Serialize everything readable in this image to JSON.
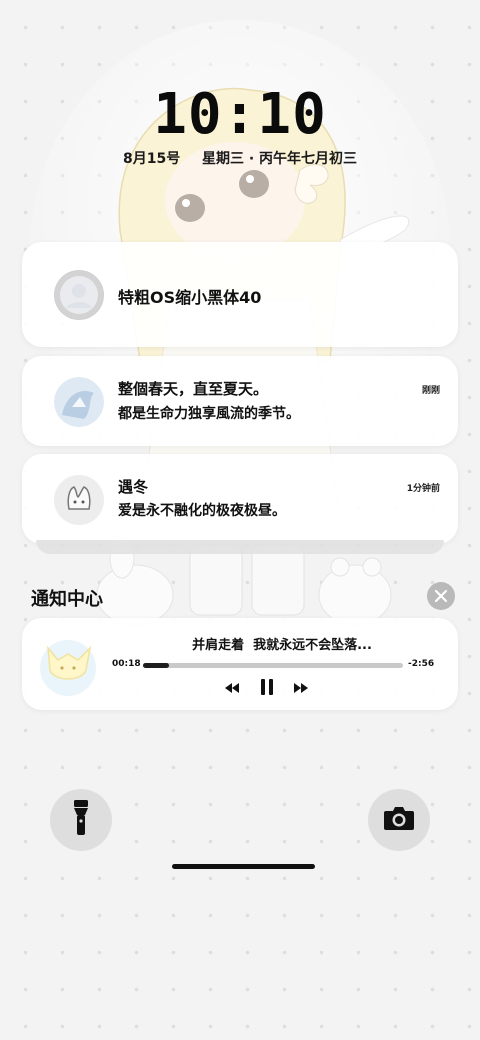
{
  "lockscreen": {
    "time": "10:10",
    "date": "8月15号",
    "weekday": "星期三",
    "separator": "·",
    "lunar_date": "丙午年七月初三"
  },
  "notifications": [
    {
      "title": "特粗OS缩小黑体40",
      "body": "",
      "time": ""
    },
    {
      "title": "整個春天，直至夏天。",
      "body": "都是生命力独享風流的季节。",
      "time": "刚刚"
    },
    {
      "title": "遇冬",
      "body": "爱是永不融化的极夜极昼。",
      "time": "1分钟前"
    }
  ],
  "notification_center": {
    "title": "通知中心",
    "close_icon": "close-icon"
  },
  "media_player": {
    "song": "并肩走着  我就永远不会坠落...",
    "elapsed": "00:18",
    "remaining": "-2:56",
    "progress": 0.1,
    "controls": [
      "rewind-icon",
      "pause-icon",
      "fast-forward-icon"
    ]
  },
  "quick_actions": {
    "left_icon": "flashlight-icon",
    "right_icon": "camera-icon"
  }
}
